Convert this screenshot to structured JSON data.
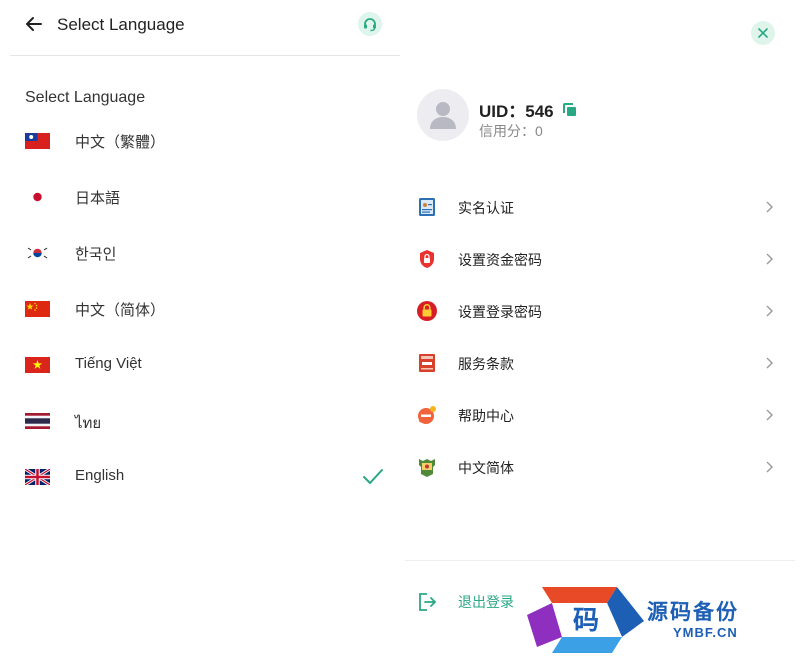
{
  "header": {
    "title": "Select Language"
  },
  "section_title": "Select Language",
  "languages": [
    {
      "label": "中文（繁體）",
      "flag": "taiwan-flag"
    },
    {
      "label": "日本語",
      "flag": "japan-flag"
    },
    {
      "label": "한국인",
      "flag": "korea-flag"
    },
    {
      "label": "中文（简体）",
      "flag": "china-flag"
    },
    {
      "label": "Tiếng Việt",
      "flag": "vietnam-flag"
    },
    {
      "label": "ไทย",
      "flag": "thailand-flag"
    },
    {
      "label": "English",
      "flag": "uk-flag",
      "selected": true
    }
  ],
  "profile": {
    "uid": "UID：546",
    "credit": "信用分：0"
  },
  "menu": [
    {
      "label": "实名认证",
      "icon": "id-card-icon"
    },
    {
      "label": "设置资金密码",
      "icon": "shield-lock-icon"
    },
    {
      "label": "设置登录密码",
      "icon": "lock-icon"
    },
    {
      "label": "服务条款",
      "icon": "rules-book-icon"
    },
    {
      "label": "帮助中心",
      "icon": "help-bubble-icon"
    },
    {
      "label": "中文简体",
      "icon": "language-flag-icon"
    }
  ],
  "logout": {
    "label": "退出登录"
  },
  "watermark": {
    "logo_char": "码",
    "title": "源码备份",
    "subtitle": "YMBF.CN"
  },
  "colors": {
    "accent": "#2aa884",
    "accent_bg": "#dff5ec",
    "watermark_blue": "#1d5fb5"
  }
}
